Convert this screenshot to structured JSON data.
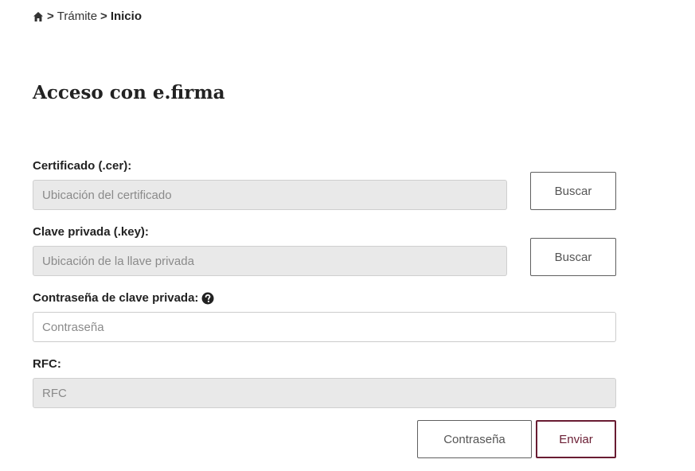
{
  "breadcrumb": {
    "home_icon": "home-icon",
    "separator": ">",
    "item": "Trámite",
    "current": "Inicio"
  },
  "page": {
    "title": "Acceso con e.firma"
  },
  "form": {
    "certificate": {
      "label": "Certificado (.cer):",
      "placeholder": "Ubicación del certificado",
      "button": "Buscar"
    },
    "private_key": {
      "label": "Clave privada (.key):",
      "placeholder": "Ubicación de la llave privada",
      "button": "Buscar"
    },
    "password": {
      "label": "Contraseña de clave privada:",
      "help_icon": "question-circle-icon",
      "placeholder": "Contraseña"
    },
    "rfc": {
      "label": "RFC:",
      "placeholder": "RFC"
    },
    "actions": {
      "password_button": "Contraseña",
      "submit_button": "Enviar"
    }
  },
  "colors": {
    "accent": "#691c32",
    "disabled_bg": "#e9e9e9",
    "border": "#cccccc"
  }
}
